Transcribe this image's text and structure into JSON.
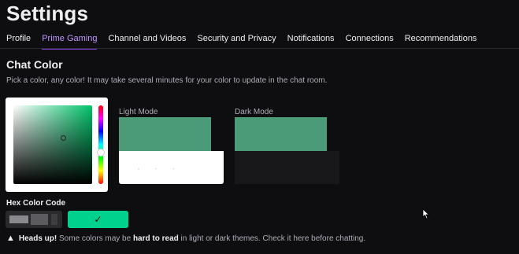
{
  "page": {
    "title": "Settings"
  },
  "tabs": [
    {
      "label": "Profile"
    },
    {
      "label": "Prime Gaming"
    },
    {
      "label": "Channel and Videos"
    },
    {
      "label": "Security and Privacy"
    },
    {
      "label": "Notifications"
    },
    {
      "label": "Connections"
    },
    {
      "label": "Recommendations"
    }
  ],
  "active_tab": "Prime Gaming",
  "chat_color": {
    "title": "Chat Color",
    "description": "Pick a color, any color! It may take several minutes for your color to update in the chat room.",
    "light_mode_label": "Light Mode",
    "dark_mode_label": "Dark Mode",
    "selected_color": "#4c9b78",
    "hex_label": "Hex Color Code",
    "confirm_icon": "checkmark-icon",
    "confirm_glyph": "✓",
    "warning": {
      "icon": "warning-icon",
      "glyph": "▲",
      "prefix": "Heads up!",
      "text1": " Some colors may be ",
      "emphasis": "hard to read",
      "text2": " in light or dark themes. Check it here before chatting."
    }
  },
  "colors": {
    "accent": "#9147ff",
    "confirm": "#00d18c",
    "background": "#0e0e10"
  }
}
